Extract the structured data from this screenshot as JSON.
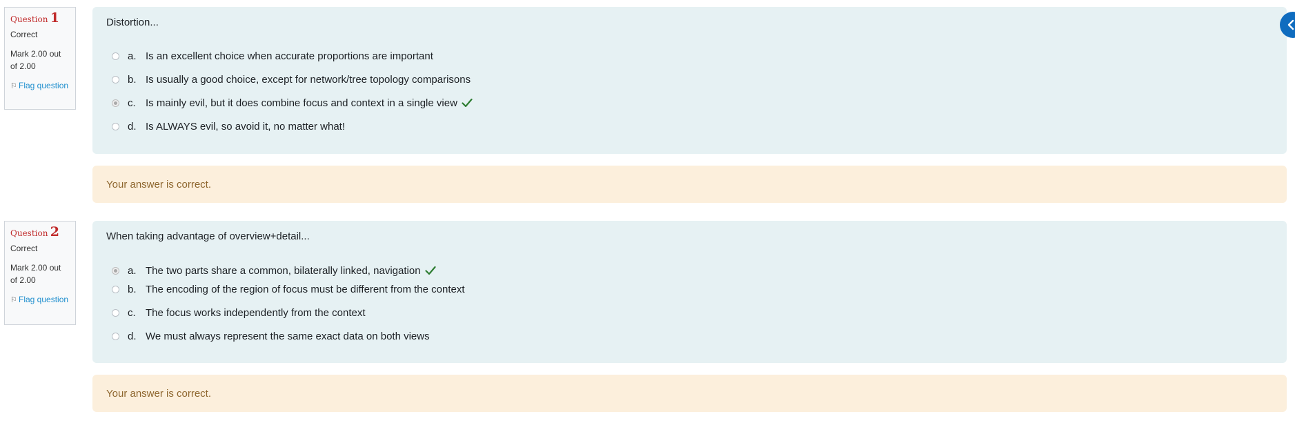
{
  "questions": [
    {
      "word": "Question",
      "number": "1",
      "state": "Correct",
      "grade": "Mark 2.00 out of 2.00",
      "flag": "Flag question",
      "text": "Distortion...",
      "answers": [
        {
          "letter": "a.",
          "text": "Is an excellent choice when accurate proportions are important"
        },
        {
          "letter": "b.",
          "text": "Is usually a good choice, except for network/tree topology comparisons"
        },
        {
          "letter": "c.",
          "text": "Is mainly evil, but it does combine focus and context in a single view"
        },
        {
          "letter": "d.",
          "text": "Is ALWAYS evil, so avoid it, no matter what!"
        }
      ],
      "selected": "c",
      "feedback": "Your answer is correct."
    },
    {
      "word": "Question",
      "number": "2",
      "state": "Correct",
      "grade": "Mark 2.00 out of 2.00",
      "flag": "Flag question",
      "text": "When taking advantage of overview+detail...",
      "answers": [
        {
          "letter": "a.",
          "text": "The two parts share a common, bilaterally linked, navigation"
        },
        {
          "letter": "b.",
          "text": "The encoding of the region of focus must be different from the context"
        },
        {
          "letter": "c.",
          "text": "The focus works independently from the context"
        },
        {
          "letter": "d.",
          "text": "We must always represent the same exact data on both views"
        }
      ],
      "selected": "a",
      "feedback": "Your answer is correct."
    }
  ],
  "icons": {
    "flag": "flag-icon",
    "tick": "check-icon",
    "drawer": "chevron-left-icon"
  },
  "colors": {
    "question_label": "#c02b2b",
    "link": "#1f8fce",
    "formulation_bg": "#e6f1f3",
    "feedback_bg": "#fcefdc",
    "feedback_text": "#8e662e",
    "tick": "#2e7d32",
    "drawer": "#0f6cbf"
  }
}
